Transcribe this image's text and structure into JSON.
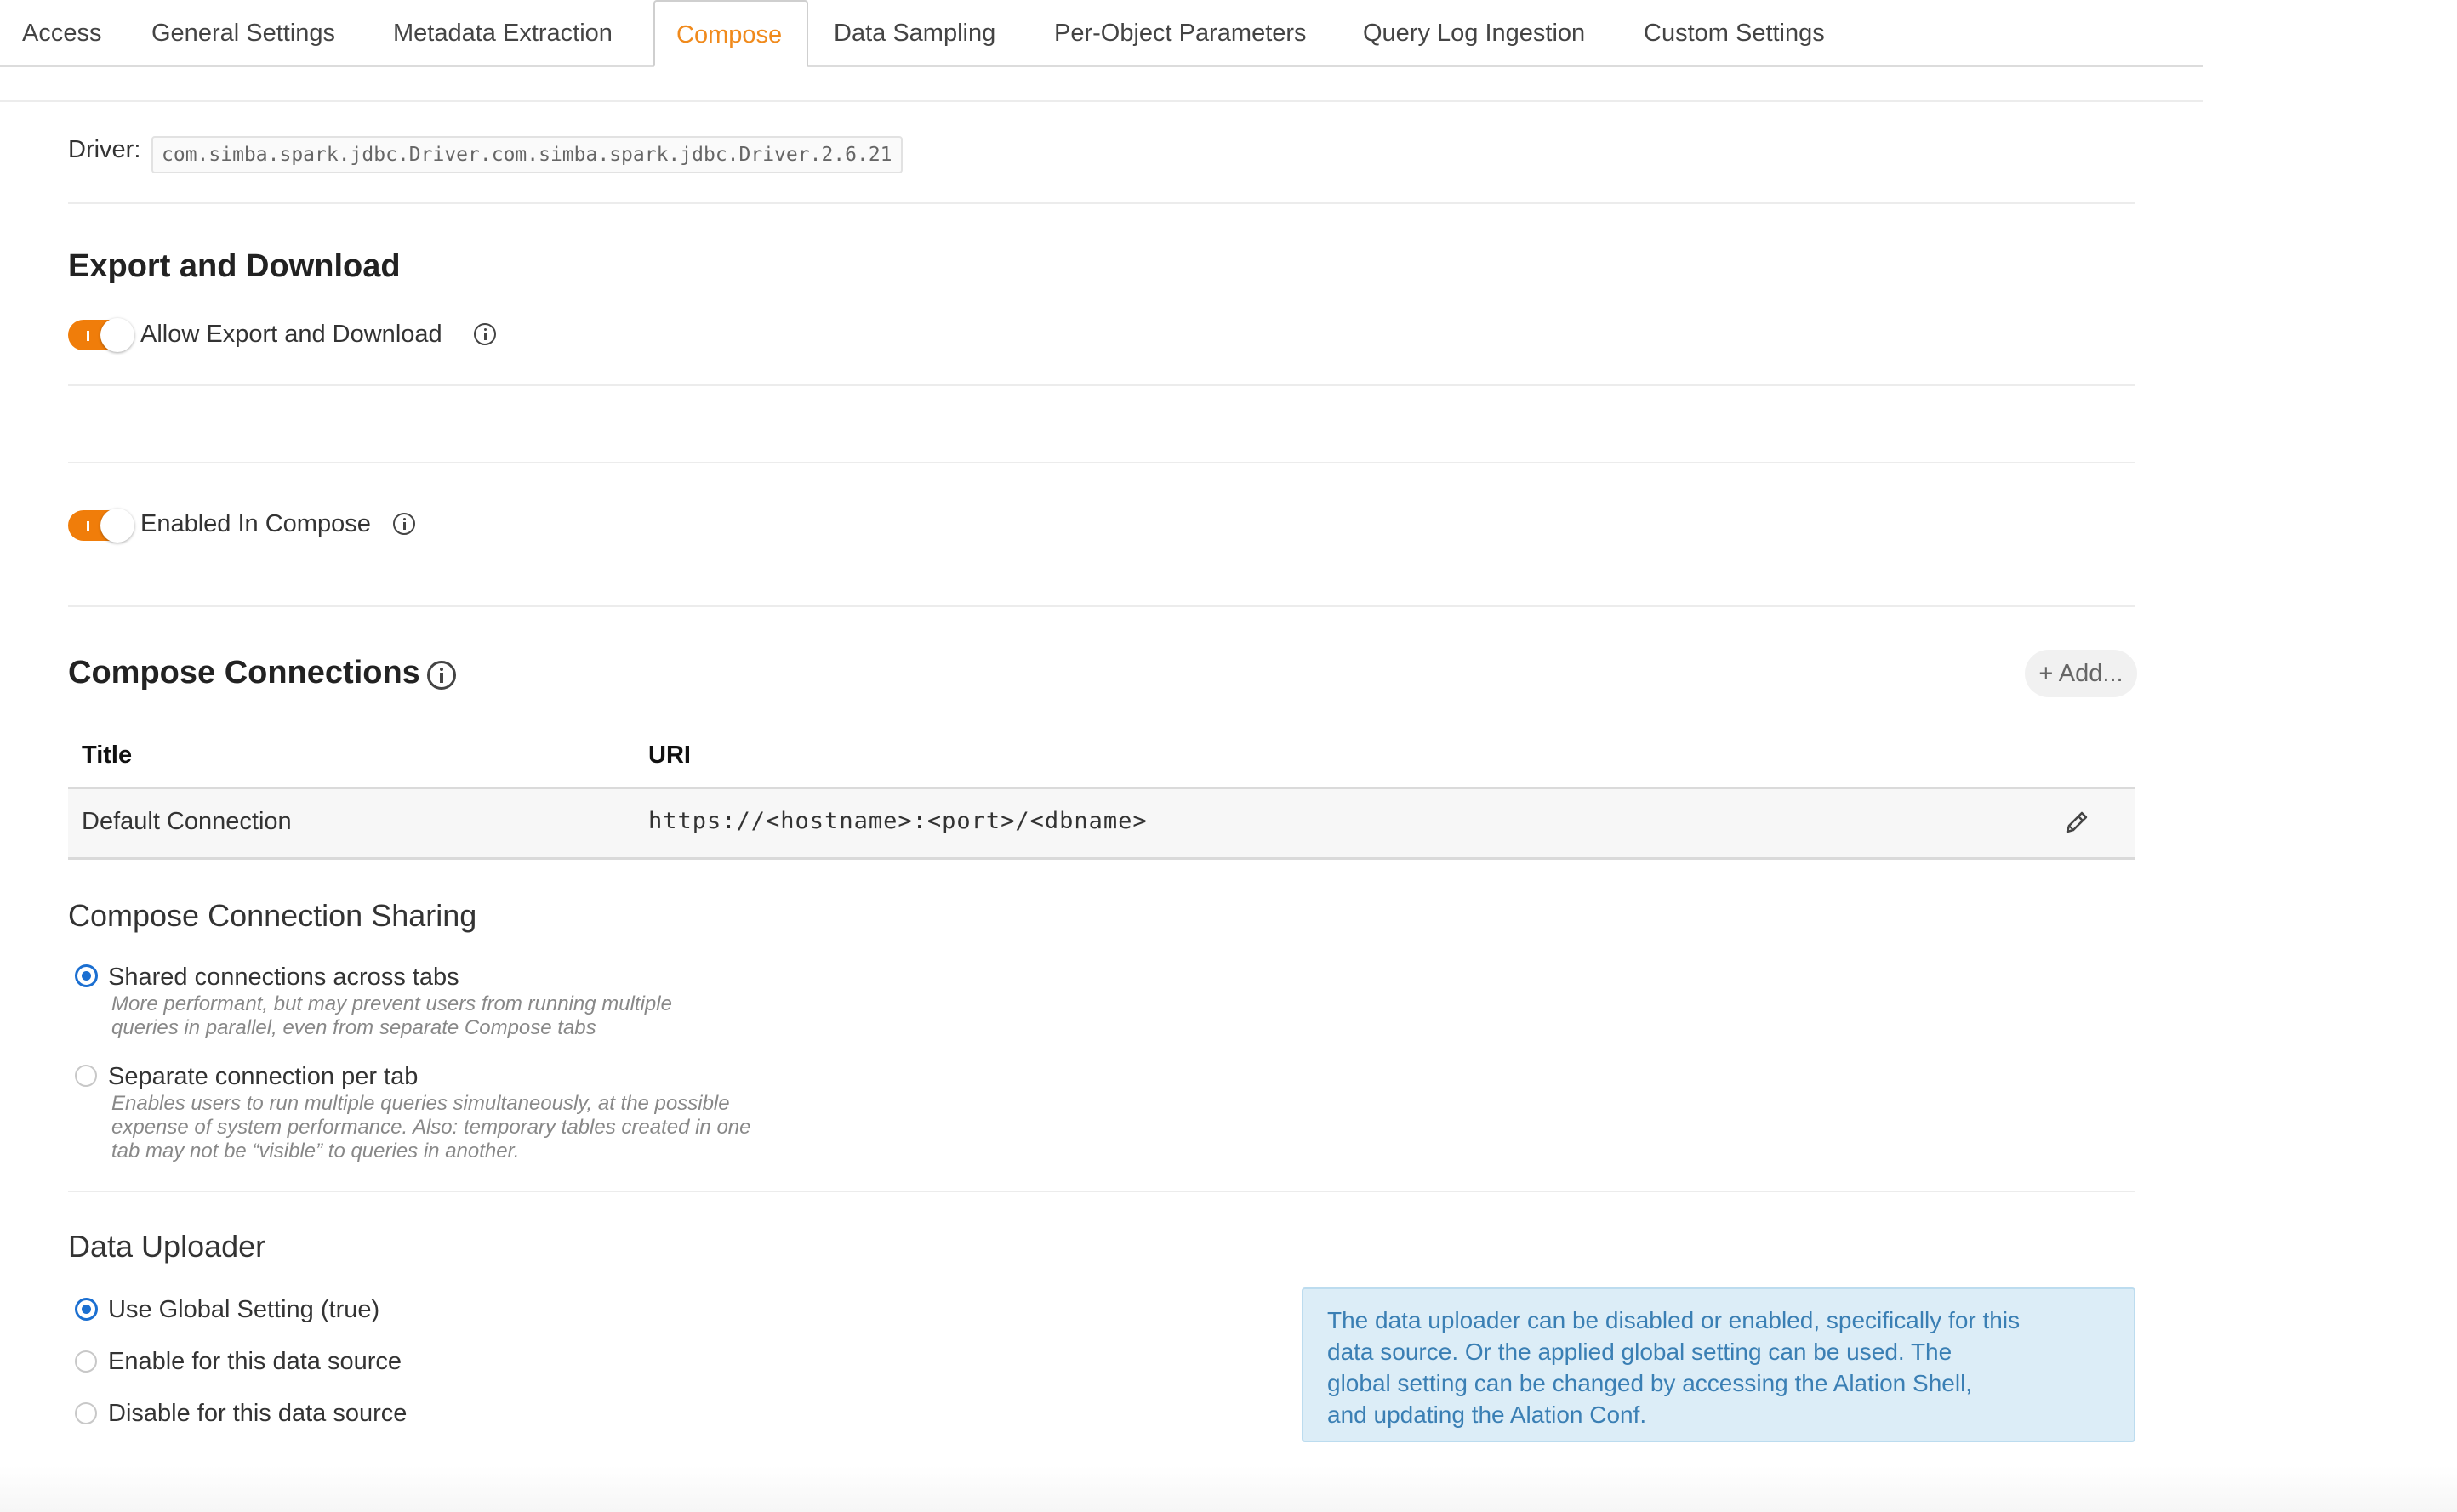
{
  "tabs": [
    {
      "label": "Access",
      "active": false
    },
    {
      "label": "General Settings",
      "active": false
    },
    {
      "label": "Metadata Extraction",
      "active": false
    },
    {
      "label": "Compose",
      "active": true
    },
    {
      "label": "Data Sampling",
      "active": false
    },
    {
      "label": "Per-Object Parameters",
      "active": false
    },
    {
      "label": "Query Log Ingestion",
      "active": false
    },
    {
      "label": "Custom Settings",
      "active": false
    }
  ],
  "driver": {
    "label": "Driver:",
    "value": "com.simba.spark.jdbc.Driver.com.simba.spark.jdbc.Driver.2.6.21"
  },
  "export": {
    "heading": "Export and Download",
    "toggle_label": "Allow Export and Download",
    "enabled": true
  },
  "compose_toggle": {
    "label": "Enabled In Compose",
    "enabled": true
  },
  "connections": {
    "heading": "Compose Connections",
    "add_label": "+ Add...",
    "columns": [
      "Title",
      "URI"
    ],
    "rows": [
      {
        "title": "Default Connection",
        "uri": "https://<hostname>:<port>/<dbname>"
      }
    ]
  },
  "sharing": {
    "heading": "Compose Connection Sharing",
    "options": [
      {
        "label": "Shared connections across tabs",
        "selected": true,
        "description_lines": [
          "More performant, but may prevent users from running multiple",
          "queries in parallel, even from separate Compose tabs"
        ]
      },
      {
        "label": "Separate connection per tab",
        "selected": false,
        "description_lines": [
          "Enables users to run multiple queries simultaneously, at the possible",
          "expense of system performance. Also: temporary tables created in one",
          "tab may not be “visible” to queries in another."
        ]
      }
    ]
  },
  "uploader": {
    "heading": "Data Uploader",
    "options": [
      {
        "label": "Use Global Setting (true)",
        "selected": true
      },
      {
        "label": "Enable for this data source",
        "selected": false
      },
      {
        "label": "Disable for this data source",
        "selected": false
      }
    ],
    "note_lines": [
      "The data uploader can be disabled or enabled, specifically for this",
      "data source. Or the applied global setting can be used. The",
      "global setting can be changed by accessing the Alation Shell,",
      "and updating the Alation Conf."
    ]
  },
  "colors": {
    "accent": "#f07d0a",
    "active_tab_text": "#f08a1c",
    "radio_selected": "#1b6fd1",
    "note_background": "#dcedf7",
    "note_text": "#3a7fb4"
  },
  "icons": {
    "info": "info-circle-icon",
    "edit": "pencil-icon"
  }
}
